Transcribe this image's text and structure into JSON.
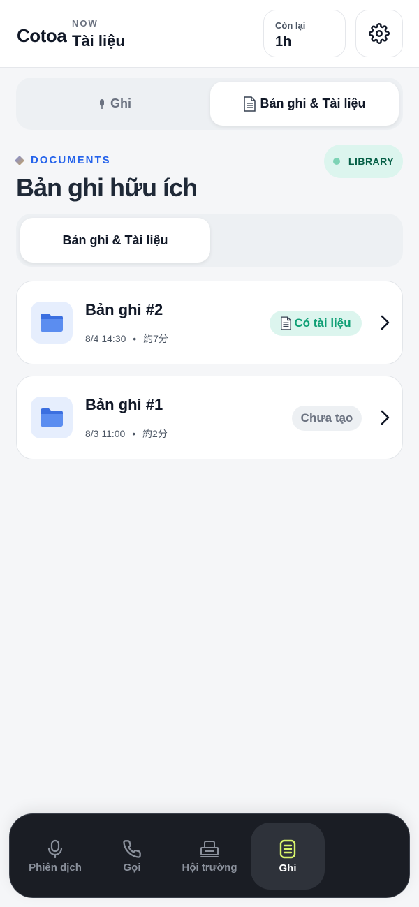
{
  "header": {
    "brand": "Cotoa",
    "now_label": "NOW",
    "now_title": "Tài liệu",
    "remaining_label": "Còn lại",
    "remaining_value": "1h"
  },
  "top_tabs": [
    {
      "label": "Ghi",
      "icon": "microphone-icon"
    },
    {
      "label": "Bản ghi & Tài liệu",
      "icon": "document-icon",
      "active": true
    }
  ],
  "section": {
    "eyebrow": "DOCUMENTS",
    "title": "Bản ghi hữu ích",
    "library_pill": "LIBRARY"
  },
  "sub_tabs": [
    {
      "label": "Bản ghi & Tài liệu",
      "active": true
    }
  ],
  "records": [
    {
      "title": "Bản ghi #2",
      "date": "8/4 14:30",
      "duration": "約7分",
      "badge": "Có tài liệu",
      "has_document": true
    },
    {
      "title": "Bản ghi #1",
      "date": "8/3 11:00",
      "duration": "約2分",
      "badge": "Chưa tạo",
      "has_document": false
    }
  ],
  "meta_separator": "•",
  "bottom_nav": [
    {
      "label": "Phiên dịch",
      "icon": "microphone-icon"
    },
    {
      "label": "Gọi",
      "icon": "phone-icon"
    },
    {
      "label": "Hội trường",
      "icon": "hall-icon"
    },
    {
      "label": "Ghi",
      "icon": "notes-icon",
      "active": true
    }
  ],
  "colors": {
    "accent_blue": "#2563eb",
    "mint_bg": "#dcf5ee",
    "mint_text": "#0f9f75",
    "nav_bg": "#1a1d24",
    "nav_active_icon": "#d9f56b"
  }
}
